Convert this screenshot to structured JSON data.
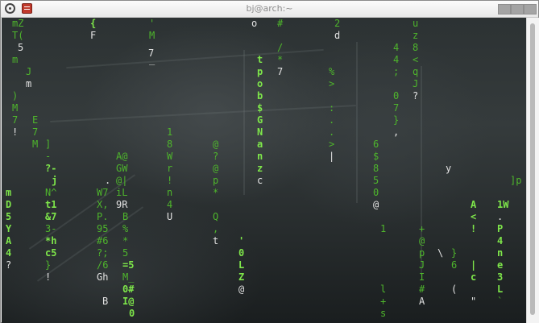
{
  "window": {
    "title": "bj@arch:~"
  },
  "terminal": {
    "lines": [
      [
        "mZ",
        "{",
        "'",
        "o",
        "#",
        "2",
        "u"
      ],
      [
        "T(",
        "F",
        "M",
        "d",
        "z"
      ],
      [
        "5",
        "/",
        "4",
        "8",
        "7"
      ],
      [
        "m",
        "_",
        "*",
        "<"
      ],
      [
        "J",
        "t",
        "7",
        "4",
        "q"
      ],
      [
        "m",
        "p",
        "%",
        ";",
        "J"
      ],
      [
        ")",
        "o",
        ">",
        "0",
        "?"
      ],
      [
        "M",
        "b",
        ":",
        "7"
      ],
      [
        "7",
        "E",
        "$",
        ".",
        "}"
      ],
      [
        "!",
        "1",
        "G",
        ".",
        ","
      ],
      [
        "7",
        "8",
        "N",
        ">",
        "|"
      ],
      [
        "M",
        "]",
        "@",
        "6"
      ],
      [
        "-",
        "A@",
        "W",
        "?",
        "a",
        "$"
      ],
      [
        "?-",
        "GW",
        "r",
        "@",
        "n",
        "8",
        "y"
      ],
      [
        "j",
        ".",
        "@|",
        "!",
        "p",
        "z",
        "5",
        "]p"
      ],
      [
        "m",
        "N^",
        "W7",
        "iL",
        "n",
        "*",
        "c",
        "0"
      ],
      [
        "D",
        "t1",
        "X,",
        "9R",
        "4",
        "@",
        "A",
        "1W"
      ],
      [
        "5",
        "&7",
        "P.",
        "B",
        "U",
        "Q",
        "<",
        "."
      ],
      [
        "Y",
        "3-",
        "95",
        "%",
        ",",
        "!",
        "P"
      ],
      [
        "A",
        "*h",
        "#6",
        "*",
        "t",
        "'",
        "1",
        "+",
        "4"
      ],
      [
        "4",
        "c5",
        "?;",
        "5",
        "0",
        "@",
        "}",
        "n"
      ],
      [
        "?",
        "}",
        "/6",
        "=5",
        "L",
        "p",
        "\\",
        "6",
        "|",
        "e"
      ],
      [
        "!",
        "Gh",
        "M_",
        "Z",
        "J",
        "c",
        "3"
      ],
      [
        "0#",
        "@",
        "I",
        "(",
        "L"
      ],
      [
        "B",
        "I@",
        "l",
        "#",
        "\""
      ],
      [
        "0",
        "+",
        "A",
        "`"
      ],
      [
        "s"
      ]
    ]
  }
}
